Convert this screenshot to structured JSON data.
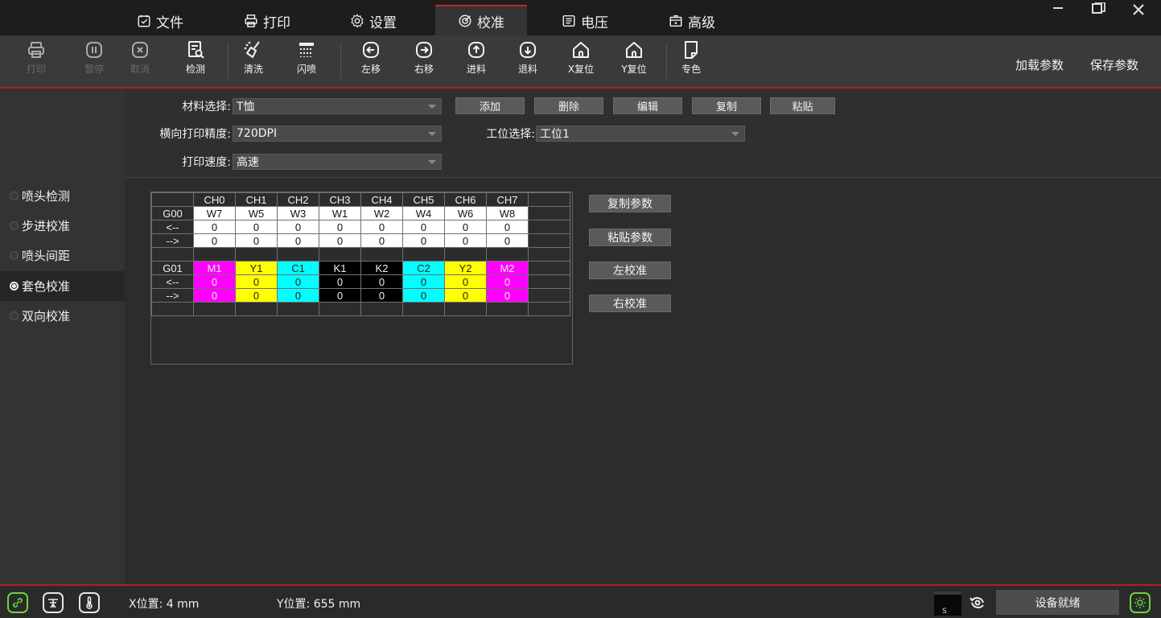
{
  "menubar": {
    "tabs": [
      {
        "label": "文件",
        "icon": "file-check-icon"
      },
      {
        "label": "打印",
        "icon": "printer-icon"
      },
      {
        "label": "设置",
        "icon": "gear-icon"
      },
      {
        "label": "校准",
        "icon": "calibrate-icon",
        "active": true
      },
      {
        "label": "电压",
        "icon": "voltage-icon"
      },
      {
        "label": "高级",
        "icon": "advanced-icon"
      }
    ],
    "window_controls": [
      "minimize-icon",
      "restore-icon",
      "close-icon"
    ]
  },
  "toolbar": {
    "buttons": [
      {
        "label": "打印",
        "icon": "printer-icon",
        "enabled": false
      },
      {
        "label": "暂停",
        "icon": "pause-icon",
        "enabled": false
      },
      {
        "label": "取消",
        "icon": "cancel-icon",
        "enabled": false
      },
      {
        "label": "检测",
        "icon": "inspect-icon",
        "enabled": true
      },
      {
        "label": "清洗",
        "icon": "clean-icon",
        "enabled": true
      },
      {
        "label": "闪喷",
        "icon": "flash-spray-icon",
        "enabled": true
      },
      {
        "label": "左移",
        "icon": "arrow-left-icon",
        "enabled": true
      },
      {
        "label": "右移",
        "icon": "arrow-right-icon",
        "enabled": true
      },
      {
        "label": "进料",
        "icon": "arrow-up-icon",
        "enabled": true
      },
      {
        "label": "退料",
        "icon": "arrow-down-icon",
        "enabled": true
      },
      {
        "label": "X复位",
        "icon": "home-icon",
        "enabled": true
      },
      {
        "label": "Y复位",
        "icon": "home-icon",
        "enabled": true
      },
      {
        "label": "专色",
        "icon": "spot-color-icon",
        "enabled": true
      }
    ],
    "load_params": "加载参数",
    "save_params": "保存参数"
  },
  "sidebar": {
    "items": [
      {
        "label": "喷头检测",
        "selected": false
      },
      {
        "label": "步进校准",
        "selected": false
      },
      {
        "label": "喷头间距",
        "selected": false
      },
      {
        "label": "套色校准",
        "selected": true
      },
      {
        "label": "双向校准",
        "selected": false
      }
    ]
  },
  "form": {
    "material_label": "材料选择:",
    "material_value": "T恤",
    "precision_label": "横向打印精度:",
    "precision_value": "720DPI",
    "speed_label": "打印速度:",
    "speed_value": "高速",
    "station_label": "工位选择:",
    "station_value": "工位1",
    "add_label": "添加",
    "delete_label": "删除",
    "edit_label": "编辑",
    "copy_label": "复制",
    "paste_label": "粘贴"
  },
  "grid": {
    "headers": [
      "",
      "CH0",
      "CH1",
      "CH2",
      "CH3",
      "CH4",
      "CH5",
      "CH6",
      "CH7"
    ],
    "groups": [
      {
        "name": "G00",
        "channels": [
          "W7",
          "W5",
          "W3",
          "W1",
          "W2",
          "W4",
          "W6",
          "W8"
        ],
        "colors": [
          "white",
          "white",
          "white",
          "white",
          "white",
          "white",
          "white",
          "white"
        ],
        "left_label": "<--",
        "left_values": [
          "0",
          "0",
          "0",
          "0",
          "0",
          "0",
          "0",
          "0"
        ],
        "right_label": "-->",
        "right_values": [
          "0",
          "0",
          "0",
          "0",
          "0",
          "0",
          "0",
          "0"
        ]
      },
      {
        "name": "G01",
        "channels": [
          "M1",
          "Y1",
          "C1",
          "K1",
          "K2",
          "C2",
          "Y2",
          "M2"
        ],
        "colors": [
          "mag",
          "yel",
          "cya",
          "blk",
          "blk",
          "cya",
          "yel",
          "mag"
        ],
        "left_label": "<--",
        "left_values": [
          "0",
          "0",
          "0",
          "0",
          "0",
          "0",
          "0",
          "0"
        ],
        "right_label": "-->",
        "right_values": [
          "0",
          "0",
          "0",
          "0",
          "0",
          "0",
          "0",
          "0"
        ]
      }
    ]
  },
  "actions": {
    "copy_params": "复制参数",
    "paste_params": "粘贴参数",
    "left_calibrate": "左校准",
    "right_calibrate": "右校准"
  },
  "status": {
    "x_position": "X位置: 4 mm",
    "y_position": "Y位置: 655 mm",
    "head_badge": "S",
    "ready": "设备就绪"
  },
  "colors": {
    "accent_red": "#a82323",
    "ready_light": "#6dd23c"
  }
}
